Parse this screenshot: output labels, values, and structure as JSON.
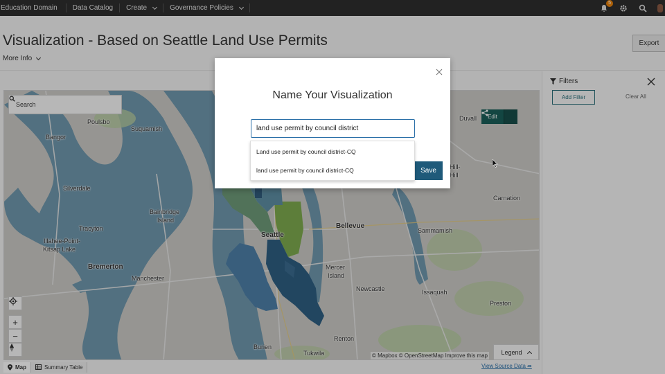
{
  "topbar": {
    "brand": "Education Domain",
    "nav": [
      "Data Catalog",
      "Create",
      "Governance Policies"
    ],
    "notification_count": "5"
  },
  "page": {
    "title": "Visualization - Based on Seattle Land Use Permits",
    "more_info": "More Info",
    "export_label": "Export"
  },
  "map": {
    "search_placeholder": "Search",
    "edit_label": "Edit",
    "labels": [
      "Poulsbo",
      "Suquamish",
      "Bangor",
      "Silverdale",
      "Bainbridge",
      "Island",
      "Tracyton",
      "Illahee-Point-",
      "Kitsap Lake",
      "Bremerton",
      "Manchester",
      "Seattle",
      "Bellevue",
      "Mercer",
      "Island",
      "Newcastle",
      "Issaquah",
      "Preston",
      "Sammamish",
      "Carnation",
      "Duvall",
      "Hill-",
      "Hill",
      "Burien",
      "Tukwila",
      "Renton"
    ],
    "legend_label": "Legend",
    "attribution": "© Mapbox © OpenStreetMap Improve this map"
  },
  "bottom": {
    "tabs": [
      "Map",
      "Summary Table"
    ],
    "view_source": "View Source Data"
  },
  "filters": {
    "title": "Filters",
    "add_filter": "Add Filter",
    "clear_all": "Clear All"
  },
  "modal": {
    "title": "Name Your Visualization",
    "input_value": "land use permit by council district",
    "save_label": "Save",
    "suggestions": [
      "Land use permit by council district-CQ",
      "land use permit by council district-CQ"
    ]
  },
  "colors": {
    "topbar": "#2e2e2e",
    "accent": "#1f5a7a",
    "water": "#6f97ad",
    "district_dark": "#2e5f82",
    "district_mid": "#4d7fa8",
    "district_green": "#79a24c"
  }
}
